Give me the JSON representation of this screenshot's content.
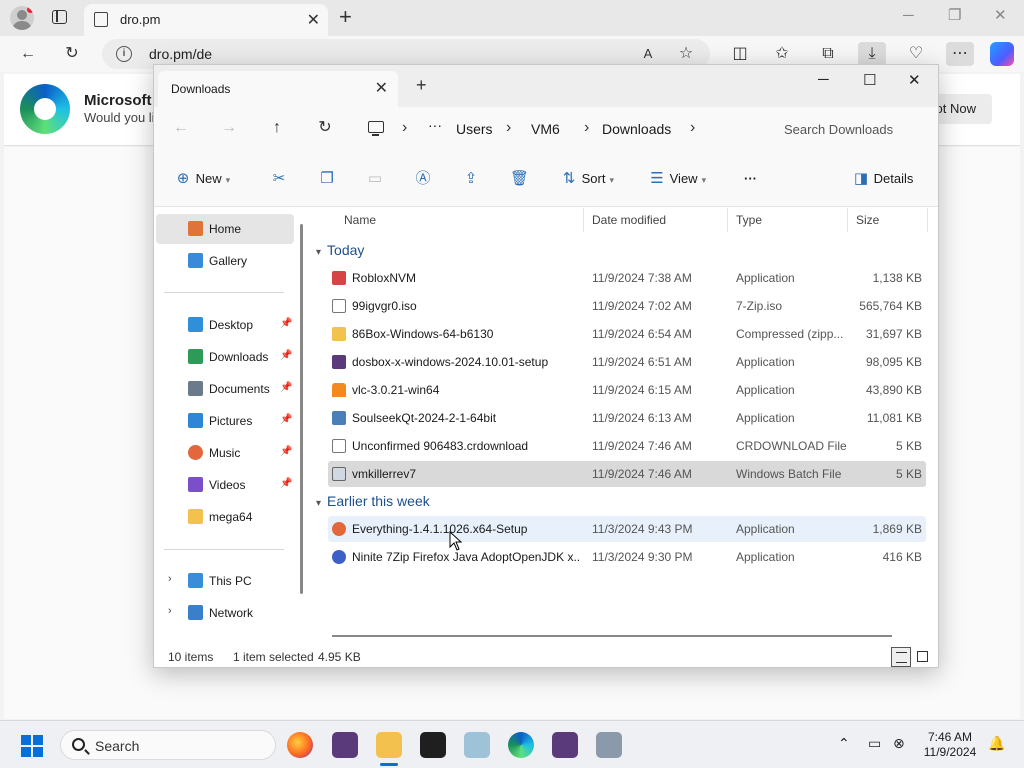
{
  "browser": {
    "tab_title": "dro.pm",
    "url": "dro.pm/de",
    "banner_title": "Microsoft E",
    "banner_subtitle": "Would you lik",
    "banner_button": "ot Now"
  },
  "explorer": {
    "tab_title": "Downloads",
    "breadcrumb": [
      "Users",
      "VM6",
      "Downloads"
    ],
    "search_placeholder": "Search Downloads",
    "commands": {
      "new": "New",
      "sort": "Sort",
      "view": "View",
      "details": "Details"
    },
    "sidebar": {
      "home": "Home",
      "gallery": "Gallery",
      "desktop": "Desktop",
      "downloads": "Downloads",
      "documents": "Documents",
      "pictures": "Pictures",
      "music": "Music",
      "videos": "Videos",
      "mega64": "mega64",
      "this_pc": "This PC",
      "network": "Network"
    },
    "columns": {
      "name": "Name",
      "date": "Date modified",
      "type": "Type",
      "size": "Size"
    },
    "groups": {
      "today": "Today",
      "earlier": "Earlier this week"
    },
    "files": [
      {
        "name": "RobloxNVM",
        "date": "11/9/2024 7:38 AM",
        "type": "Application",
        "size": "1,138 KB"
      },
      {
        "name": "99igvgr0.iso",
        "date": "11/9/2024 7:02 AM",
        "type": "7-Zip.iso",
        "size": "565,764 KB"
      },
      {
        "name": "86Box-Windows-64-b6130",
        "date": "11/9/2024 6:54 AM",
        "type": "Compressed (zipp...",
        "size": "31,697 KB"
      },
      {
        "name": "dosbox-x-windows-2024.10.01-setup",
        "date": "11/9/2024 6:51 AM",
        "type": "Application",
        "size": "98,095 KB"
      },
      {
        "name": "vlc-3.0.21-win64",
        "date": "11/9/2024 6:15 AM",
        "type": "Application",
        "size": "43,890 KB"
      },
      {
        "name": "SoulseekQt-2024-2-1-64bit",
        "date": "11/9/2024 6:13 AM",
        "type": "Application",
        "size": "11,081 KB"
      },
      {
        "name": "Unconfirmed 906483.crdownload",
        "date": "11/9/2024 7:46 AM",
        "type": "CRDOWNLOAD File",
        "size": "5 KB"
      },
      {
        "name": "vmkillerrev7",
        "date": "11/9/2024 7:46 AM",
        "type": "Windows Batch File",
        "size": "5 KB"
      },
      {
        "name": "Everything-1.4.1.1026.x64-Setup",
        "date": "11/3/2024 9:43 PM",
        "type": "Application",
        "size": "1,869 KB"
      },
      {
        "name": "Ninite 7Zip Firefox Java AdoptOpenJDK x...",
        "date": "11/3/2024 9:30 PM",
        "type": "Application",
        "size": "416 KB"
      }
    ],
    "status": {
      "count": "10 items",
      "selected": "1 item selected",
      "selected_size": "4.95 KB"
    }
  },
  "taskbar": {
    "search_label": "Search",
    "time": "7:46 AM",
    "date": "11/9/2024"
  },
  "colors": {
    "accent": "#0a6ed8",
    "group_header": "#1e4f8c",
    "selected_row": "#d9d9d9",
    "hover_row": "#e8f1fb"
  }
}
